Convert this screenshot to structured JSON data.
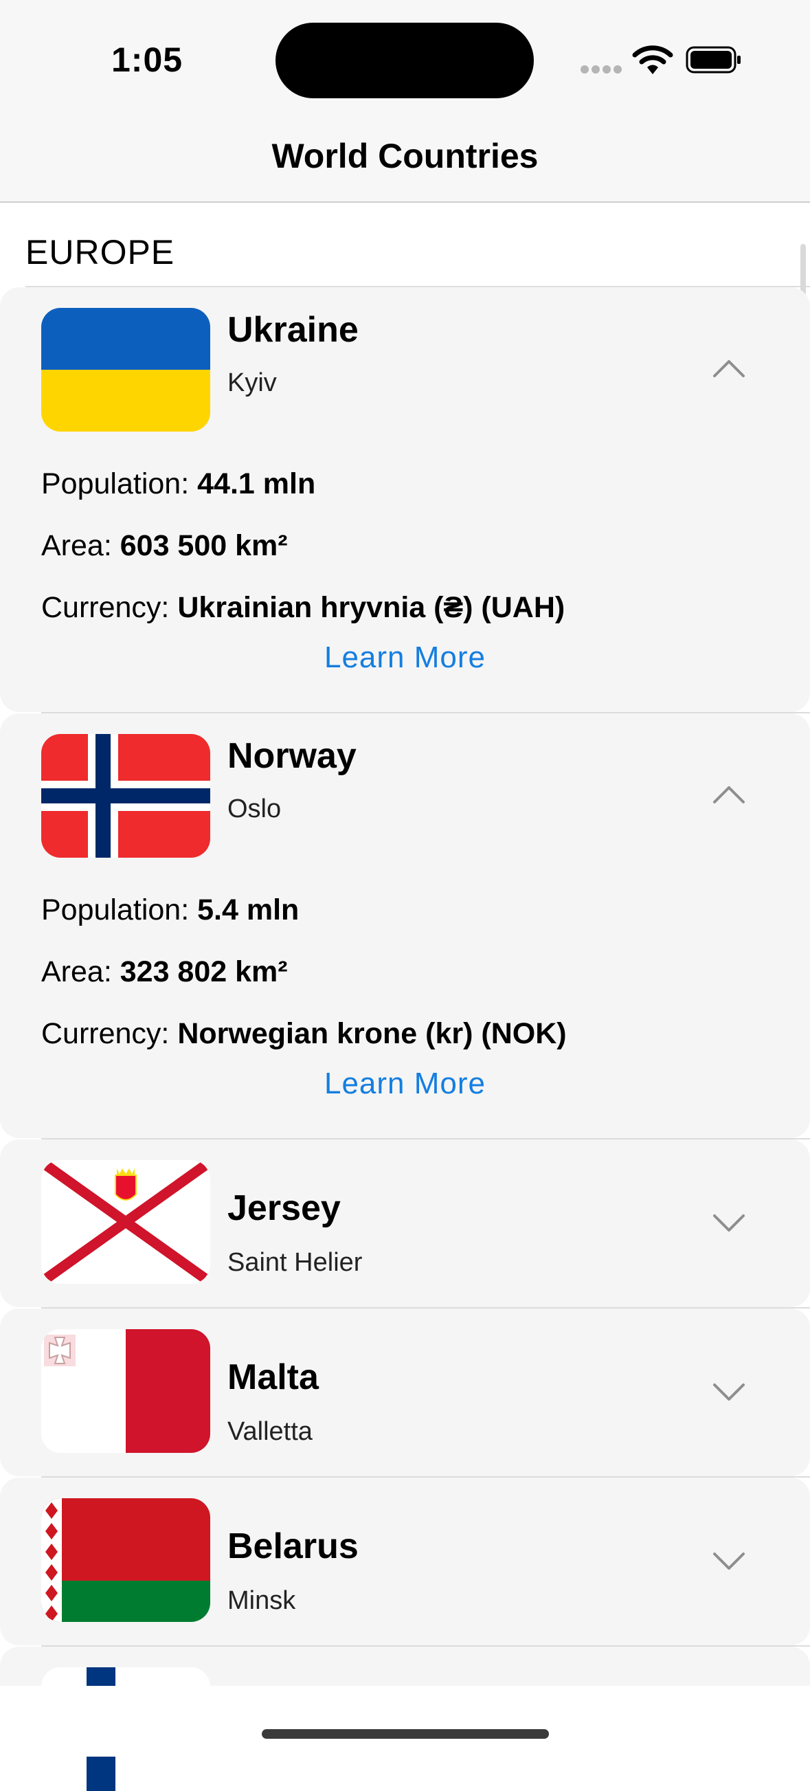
{
  "status_bar": {
    "time": "1:05",
    "wifi_icon": "wifi-icon",
    "battery_icon": "battery-icon"
  },
  "nav": {
    "title": "World Countries"
  },
  "section": {
    "header": "EUROPE"
  },
  "countries": [
    {
      "name": "Ukraine",
      "capital": "Kyiv",
      "expanded": true,
      "population_label": "Population:",
      "population_value": "44.1 mln",
      "area_label": "Area:",
      "area_value": "603 500 km²",
      "currency_label": "Currency:",
      "currency_value": "Ukrainian hryvnia (₴) (UAH)",
      "learn_more": "Learn More",
      "flag_icon": "ukraine-flag",
      "chevron": "chevron-up-icon"
    },
    {
      "name": "Norway",
      "capital": "Oslo",
      "expanded": true,
      "population_label": "Population:",
      "population_value": "5.4 mln",
      "area_label": "Area:",
      "area_value": "323 802 km²",
      "currency_label": "Currency:",
      "currency_value": "Norwegian krone (kr) (NOK)",
      "learn_more": "Learn More",
      "flag_icon": "norway-flag",
      "chevron": "chevron-up-icon"
    },
    {
      "name": "Jersey",
      "capital": "Saint Helier",
      "expanded": false,
      "flag_icon": "jersey-flag",
      "chevron": "chevron-down-icon"
    },
    {
      "name": "Malta",
      "capital": "Valletta",
      "expanded": false,
      "flag_icon": "malta-flag",
      "chevron": "chevron-down-icon"
    },
    {
      "name": "Belarus",
      "capital": "Minsk",
      "expanded": false,
      "flag_icon": "belarus-flag",
      "chevron": "chevron-down-icon"
    }
  ],
  "colors": {
    "accent": "#147ee0",
    "card_background": "#f5f5f5",
    "bar_background": "#f7f7f7"
  }
}
